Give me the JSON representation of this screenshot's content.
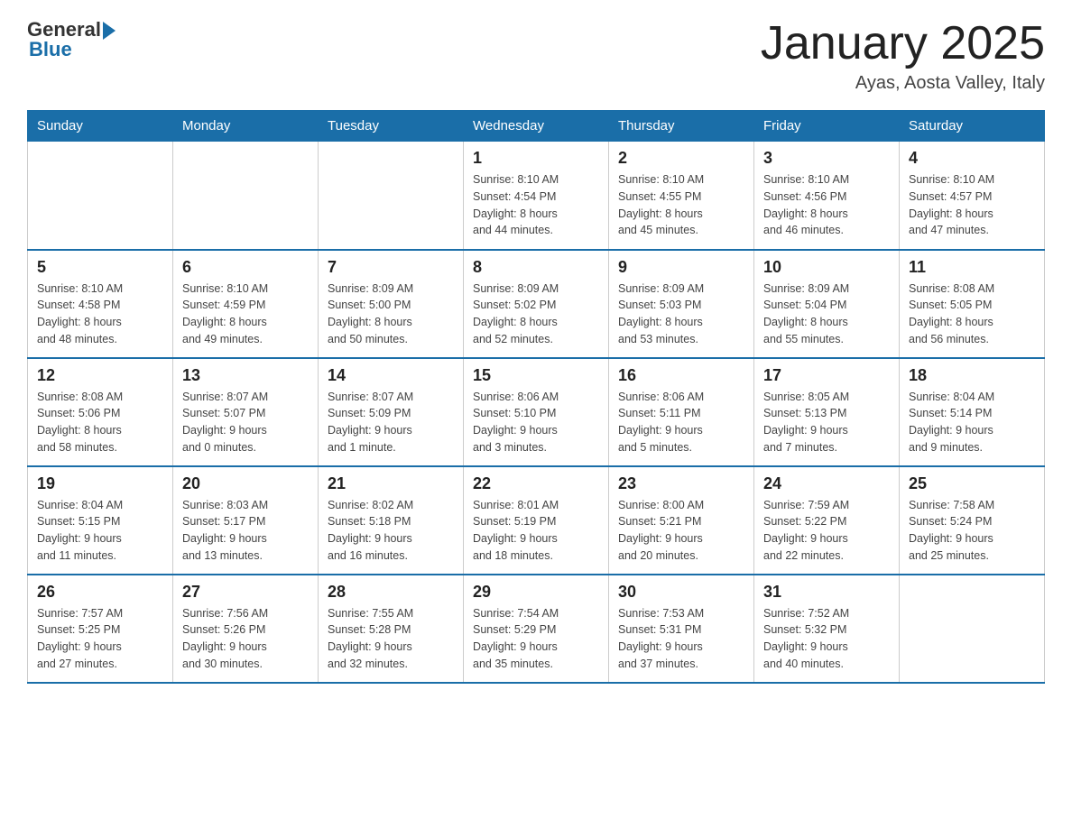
{
  "header": {
    "logo_general": "General",
    "logo_blue": "Blue",
    "month_title": "January 2025",
    "location": "Ayas, Aosta Valley, Italy"
  },
  "days_of_week": [
    "Sunday",
    "Monday",
    "Tuesday",
    "Wednesday",
    "Thursday",
    "Friday",
    "Saturday"
  ],
  "weeks": [
    [
      {
        "day": "",
        "info": ""
      },
      {
        "day": "",
        "info": ""
      },
      {
        "day": "",
        "info": ""
      },
      {
        "day": "1",
        "info": "Sunrise: 8:10 AM\nSunset: 4:54 PM\nDaylight: 8 hours\nand 44 minutes."
      },
      {
        "day": "2",
        "info": "Sunrise: 8:10 AM\nSunset: 4:55 PM\nDaylight: 8 hours\nand 45 minutes."
      },
      {
        "day": "3",
        "info": "Sunrise: 8:10 AM\nSunset: 4:56 PM\nDaylight: 8 hours\nand 46 minutes."
      },
      {
        "day": "4",
        "info": "Sunrise: 8:10 AM\nSunset: 4:57 PM\nDaylight: 8 hours\nand 47 minutes."
      }
    ],
    [
      {
        "day": "5",
        "info": "Sunrise: 8:10 AM\nSunset: 4:58 PM\nDaylight: 8 hours\nand 48 minutes."
      },
      {
        "day": "6",
        "info": "Sunrise: 8:10 AM\nSunset: 4:59 PM\nDaylight: 8 hours\nand 49 minutes."
      },
      {
        "day": "7",
        "info": "Sunrise: 8:09 AM\nSunset: 5:00 PM\nDaylight: 8 hours\nand 50 minutes."
      },
      {
        "day": "8",
        "info": "Sunrise: 8:09 AM\nSunset: 5:02 PM\nDaylight: 8 hours\nand 52 minutes."
      },
      {
        "day": "9",
        "info": "Sunrise: 8:09 AM\nSunset: 5:03 PM\nDaylight: 8 hours\nand 53 minutes."
      },
      {
        "day": "10",
        "info": "Sunrise: 8:09 AM\nSunset: 5:04 PM\nDaylight: 8 hours\nand 55 minutes."
      },
      {
        "day": "11",
        "info": "Sunrise: 8:08 AM\nSunset: 5:05 PM\nDaylight: 8 hours\nand 56 minutes."
      }
    ],
    [
      {
        "day": "12",
        "info": "Sunrise: 8:08 AM\nSunset: 5:06 PM\nDaylight: 8 hours\nand 58 minutes."
      },
      {
        "day": "13",
        "info": "Sunrise: 8:07 AM\nSunset: 5:07 PM\nDaylight: 9 hours\nand 0 minutes."
      },
      {
        "day": "14",
        "info": "Sunrise: 8:07 AM\nSunset: 5:09 PM\nDaylight: 9 hours\nand 1 minute."
      },
      {
        "day": "15",
        "info": "Sunrise: 8:06 AM\nSunset: 5:10 PM\nDaylight: 9 hours\nand 3 minutes."
      },
      {
        "day": "16",
        "info": "Sunrise: 8:06 AM\nSunset: 5:11 PM\nDaylight: 9 hours\nand 5 minutes."
      },
      {
        "day": "17",
        "info": "Sunrise: 8:05 AM\nSunset: 5:13 PM\nDaylight: 9 hours\nand 7 minutes."
      },
      {
        "day": "18",
        "info": "Sunrise: 8:04 AM\nSunset: 5:14 PM\nDaylight: 9 hours\nand 9 minutes."
      }
    ],
    [
      {
        "day": "19",
        "info": "Sunrise: 8:04 AM\nSunset: 5:15 PM\nDaylight: 9 hours\nand 11 minutes."
      },
      {
        "day": "20",
        "info": "Sunrise: 8:03 AM\nSunset: 5:17 PM\nDaylight: 9 hours\nand 13 minutes."
      },
      {
        "day": "21",
        "info": "Sunrise: 8:02 AM\nSunset: 5:18 PM\nDaylight: 9 hours\nand 16 minutes."
      },
      {
        "day": "22",
        "info": "Sunrise: 8:01 AM\nSunset: 5:19 PM\nDaylight: 9 hours\nand 18 minutes."
      },
      {
        "day": "23",
        "info": "Sunrise: 8:00 AM\nSunset: 5:21 PM\nDaylight: 9 hours\nand 20 minutes."
      },
      {
        "day": "24",
        "info": "Sunrise: 7:59 AM\nSunset: 5:22 PM\nDaylight: 9 hours\nand 22 minutes."
      },
      {
        "day": "25",
        "info": "Sunrise: 7:58 AM\nSunset: 5:24 PM\nDaylight: 9 hours\nand 25 minutes."
      }
    ],
    [
      {
        "day": "26",
        "info": "Sunrise: 7:57 AM\nSunset: 5:25 PM\nDaylight: 9 hours\nand 27 minutes."
      },
      {
        "day": "27",
        "info": "Sunrise: 7:56 AM\nSunset: 5:26 PM\nDaylight: 9 hours\nand 30 minutes."
      },
      {
        "day": "28",
        "info": "Sunrise: 7:55 AM\nSunset: 5:28 PM\nDaylight: 9 hours\nand 32 minutes."
      },
      {
        "day": "29",
        "info": "Sunrise: 7:54 AM\nSunset: 5:29 PM\nDaylight: 9 hours\nand 35 minutes."
      },
      {
        "day": "30",
        "info": "Sunrise: 7:53 AM\nSunset: 5:31 PM\nDaylight: 9 hours\nand 37 minutes."
      },
      {
        "day": "31",
        "info": "Sunrise: 7:52 AM\nSunset: 5:32 PM\nDaylight: 9 hours\nand 40 minutes."
      },
      {
        "day": "",
        "info": ""
      }
    ]
  ]
}
